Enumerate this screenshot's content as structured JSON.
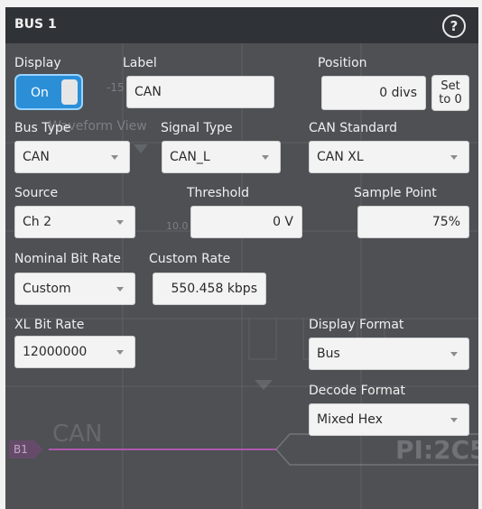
{
  "dialog": {
    "title": "BUS 1",
    "help_icon": "question-circle-icon"
  },
  "display": {
    "label": "Display",
    "toggle_text": "On",
    "state": "on"
  },
  "label_field": {
    "label": "Label",
    "value": "CAN"
  },
  "position": {
    "label": "Position",
    "value": "0 divs",
    "set_button_line1": "Set",
    "set_button_line2": "to 0"
  },
  "bus_type": {
    "label": "Bus Type",
    "value": "CAN"
  },
  "signal_type": {
    "label": "Signal Type",
    "value": "CAN_L"
  },
  "can_standard": {
    "label": "CAN Standard",
    "value": "CAN XL"
  },
  "source": {
    "label": "Source",
    "value": "Ch 2"
  },
  "threshold": {
    "label": "Threshold",
    "value": "0 V"
  },
  "sample_point": {
    "label": "Sample Point",
    "value": "75%"
  },
  "nominal_bit_rate": {
    "label": "Nominal Bit Rate",
    "value": "Custom"
  },
  "custom_rate": {
    "label": "Custom Rate",
    "value": "550.458 kbps"
  },
  "xl_bit_rate": {
    "label": "XL Bit Rate",
    "value": "12000000"
  },
  "display_format": {
    "label": "Display Format",
    "value": "Bus"
  },
  "decode_format": {
    "label": "Decode Format",
    "value": "Mixed Hex"
  },
  "background": {
    "waveform_view_text": "Waveform View",
    "bus_name": "CAN",
    "bus_badge": "B1",
    "decode_text": "PI:2C5",
    "scale_a": "-15",
    "scale_b": "10.0"
  },
  "colors": {
    "accent": "#2b8fd8",
    "panel": "#4e5054",
    "titlebar": "#2f3237",
    "bus_trace": "#c65ac0"
  }
}
